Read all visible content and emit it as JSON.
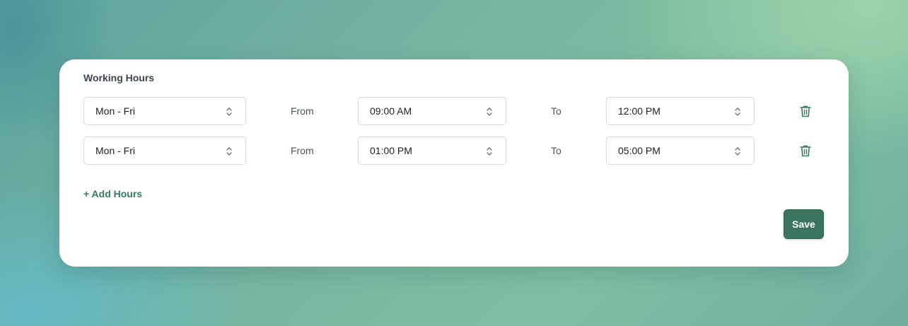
{
  "panel": {
    "title": "Working Hours",
    "rows": [
      {
        "days": "Mon - Fri",
        "from_label": "From",
        "from_time": "09:00 AM",
        "to_label": "To",
        "to_time": "12:00 PM",
        "delete_icon": "trash-icon"
      },
      {
        "days": "Mon - Fri",
        "from_label": "From",
        "from_time": "01:00 PM",
        "to_label": "To",
        "to_time": "05:00 PM",
        "delete_icon": "trash-icon"
      }
    ],
    "add_hours_label": "+ Add Hours",
    "save_label": "Save"
  },
  "colors": {
    "accent": "#3b7560",
    "link": "#3a7a5f",
    "border": "#d6dadf"
  }
}
